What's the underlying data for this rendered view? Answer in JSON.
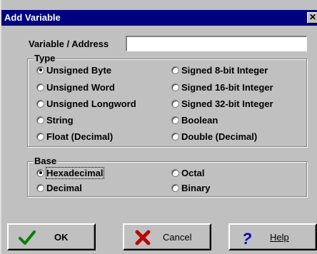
{
  "window": {
    "title": "Add Variable",
    "close_glyph": "✕"
  },
  "address": {
    "label": "Variable / Address",
    "value": ""
  },
  "type_group": {
    "legend": "Type",
    "selected": "Unsigned Byte",
    "options": [
      "Unsigned Byte",
      "Signed 8-bit Integer",
      "Unsigned Word",
      "Signed 16-bit Integer",
      "Unsigned Longword",
      "Signed 32-bit Integer",
      "String",
      "Boolean",
      "Float (Decimal)",
      "Double (Decimal)"
    ]
  },
  "base_group": {
    "legend": "Base",
    "selected": "Hexadecimal",
    "options": [
      "Hexadecimal",
      "Octal",
      "Decimal",
      "Binary"
    ]
  },
  "buttons": {
    "ok": {
      "label": "OK",
      "icon": "checkmark-icon",
      "color": "#008000"
    },
    "cancel": {
      "label": "Cancel",
      "icon": "x-icon",
      "color": "#c00000"
    },
    "help": {
      "label": "Help",
      "icon": "question-icon",
      "color": "#0000c0"
    }
  }
}
